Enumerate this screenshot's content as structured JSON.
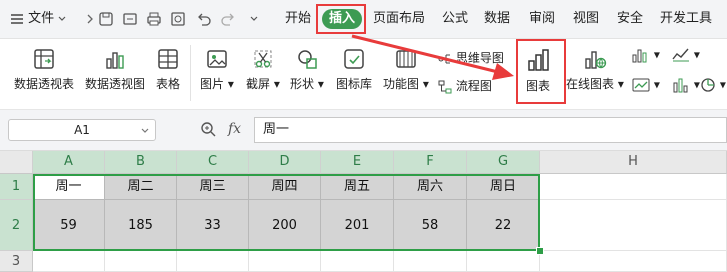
{
  "menubar": {
    "file_label": "文件",
    "tabs": [
      "开始",
      "插入",
      "页面布局",
      "公式",
      "数据",
      "审阅",
      "视图",
      "安全",
      "开发工具"
    ]
  },
  "ribbon": {
    "pivot_table": "数据透视表",
    "pivot_chart": "数据透视图",
    "table": "表格",
    "picture": "图片",
    "screenshot": "截屏",
    "shapes": "形状",
    "icon_library": "图标库",
    "function_chart": "功能图",
    "mind_map": "思维导图",
    "flowchart": "流程图",
    "chart": "图表",
    "online_chart": "在线图表"
  },
  "formula_bar": {
    "cell_ref": "A1",
    "fx": "fx",
    "content": "周一"
  },
  "sheet": {
    "columns": [
      "A",
      "B",
      "C",
      "D",
      "E",
      "F",
      "G",
      "H"
    ],
    "rows": [
      "1",
      "2",
      "3"
    ],
    "row1": [
      "周一",
      "周二",
      "周三",
      "周四",
      "周五",
      "周六",
      "周日"
    ],
    "row2": [
      "59",
      "185",
      "33",
      "200",
      "201",
      "58",
      "22"
    ]
  },
  "colors": {
    "accent_green": "#3d9b53",
    "highlight_red": "#e83b3b",
    "selection_green": "#2e9e47"
  }
}
